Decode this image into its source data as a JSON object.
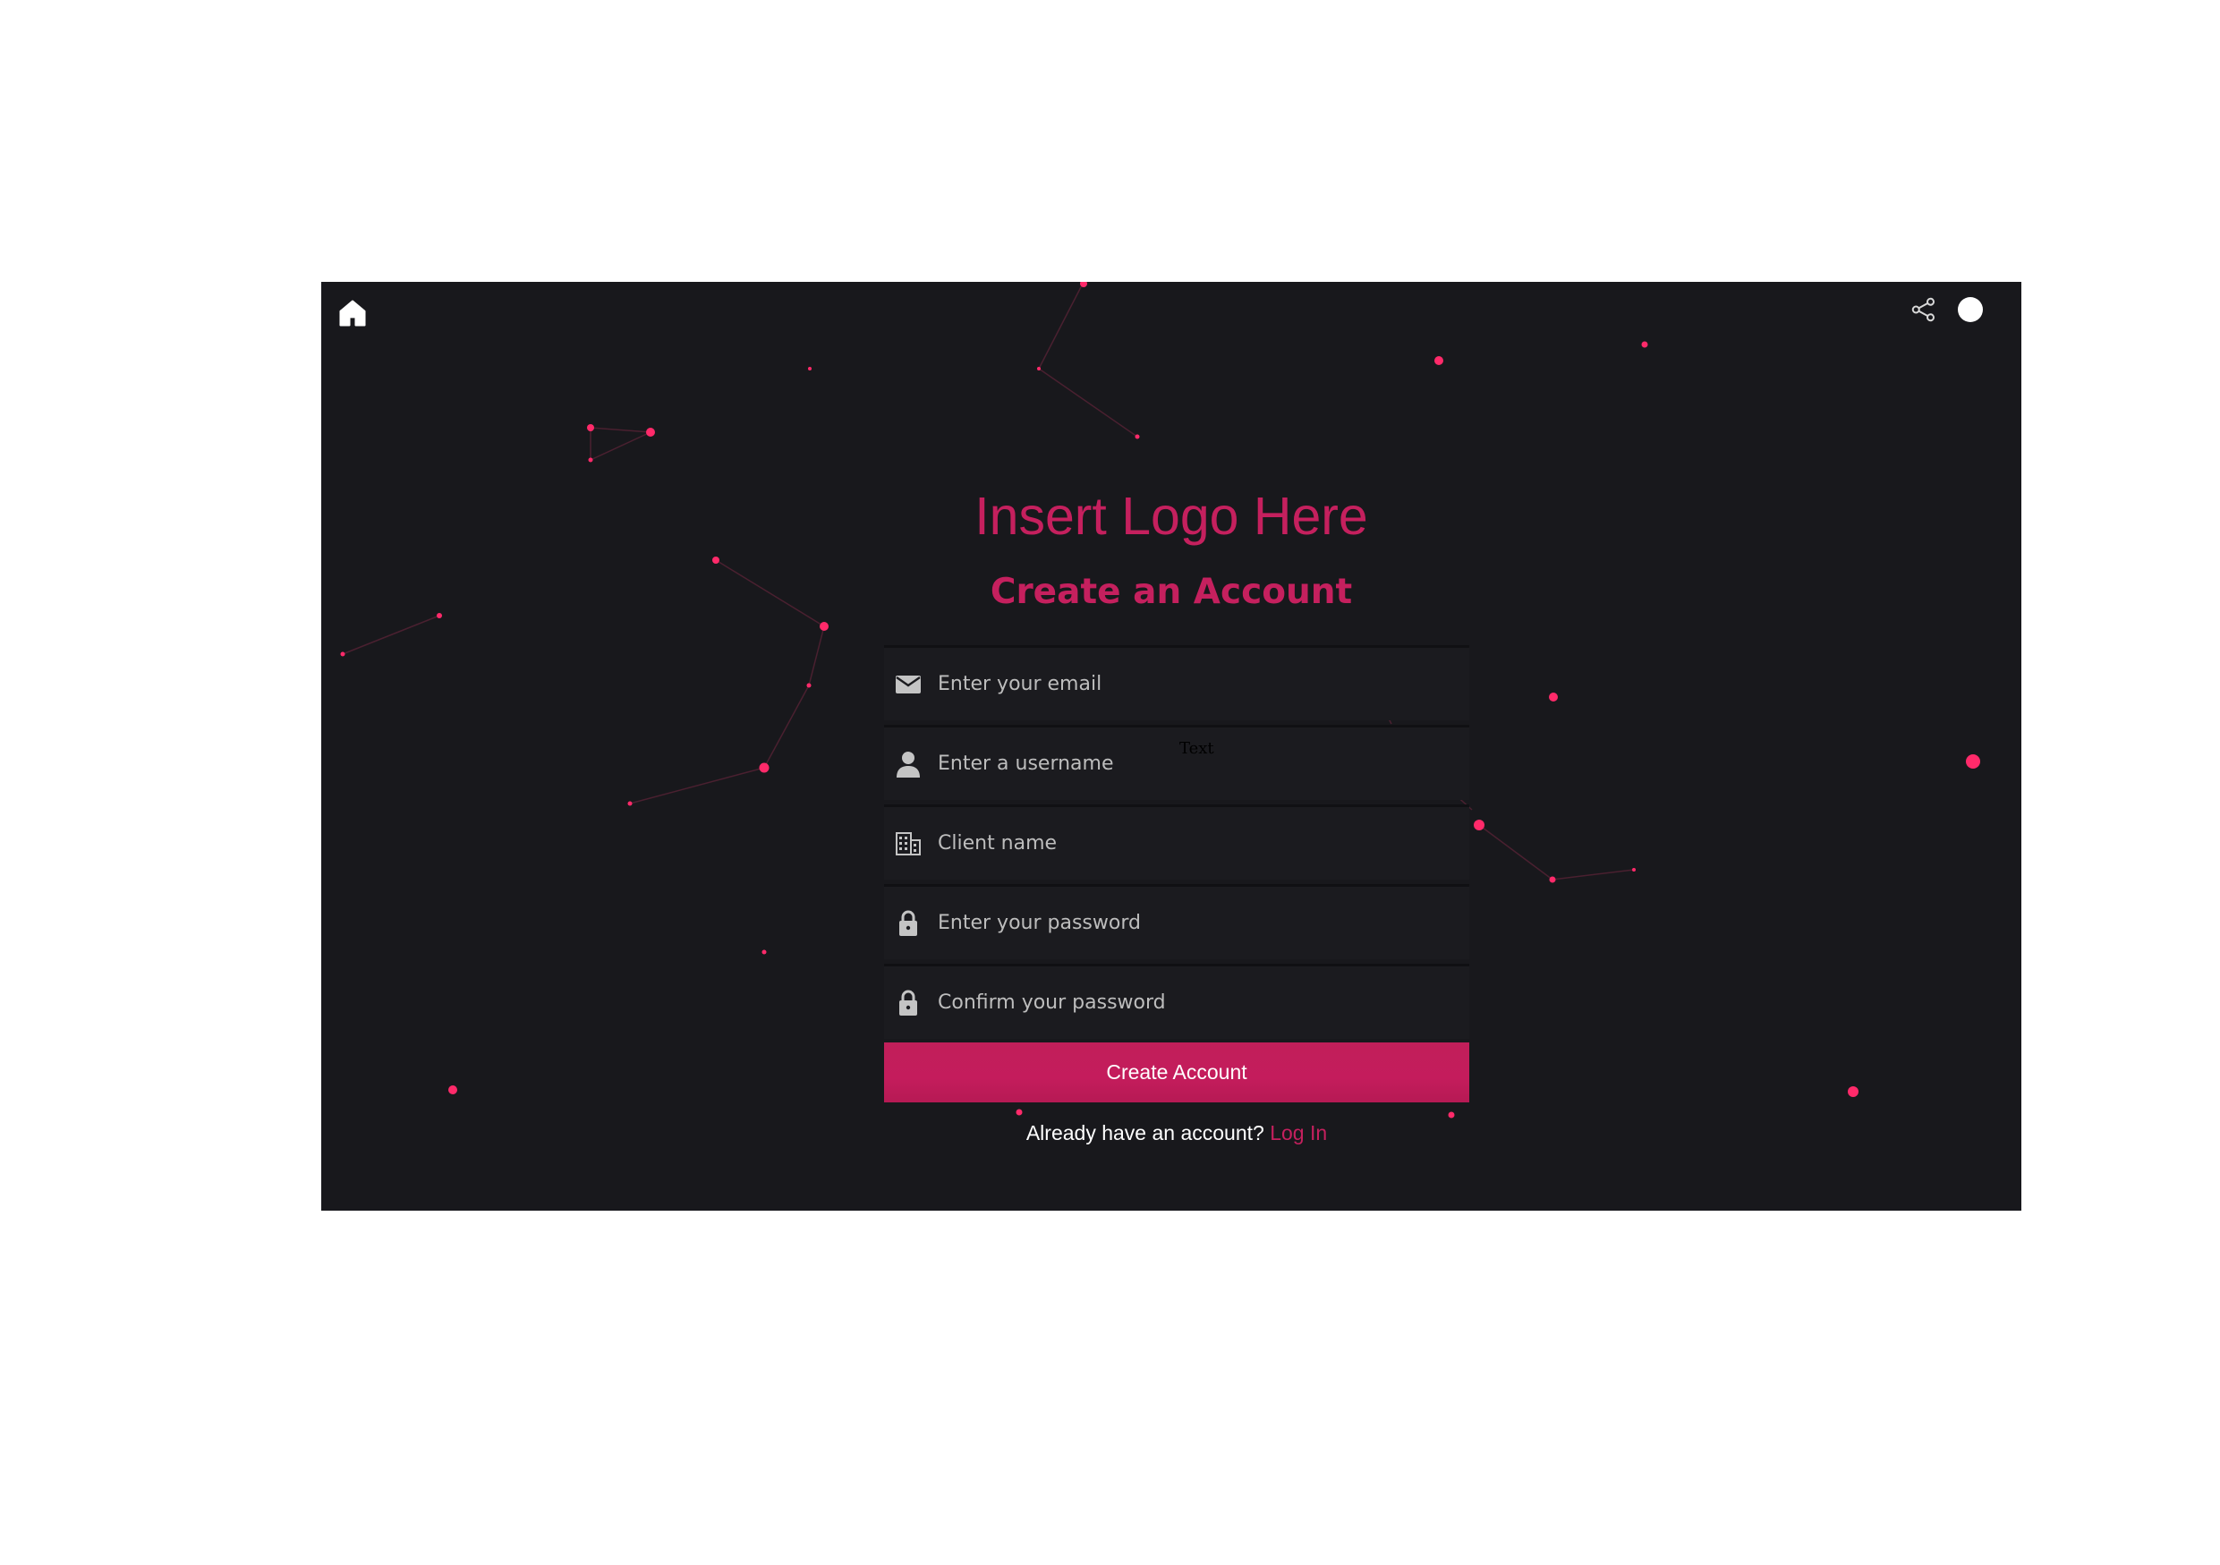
{
  "header": {
    "home_icon": "home-icon",
    "share_icon": "share-icon",
    "theme_toggle": "theme-toggle"
  },
  "brand": {
    "logo_text": "Insert Logo Here"
  },
  "form": {
    "title": "Create an Account",
    "fields": [
      {
        "icon": "mail-icon",
        "placeholder": "Enter your email"
      },
      {
        "icon": "user-icon",
        "placeholder": "Enter a username",
        "overlay_text": "Text"
      },
      {
        "icon": "building-icon",
        "placeholder": "Client name"
      },
      {
        "icon": "lock-icon",
        "placeholder": "Enter your password"
      },
      {
        "icon": "lock-icon",
        "placeholder": "Confirm your password"
      }
    ],
    "submit_label": "Create Account",
    "login_prompt": "Already have an account?",
    "login_link": "Log In"
  },
  "colors": {
    "background": "#18181c",
    "accent": "#c5205e",
    "particle": "#ff2a6a",
    "page": "#ffffff"
  }
}
